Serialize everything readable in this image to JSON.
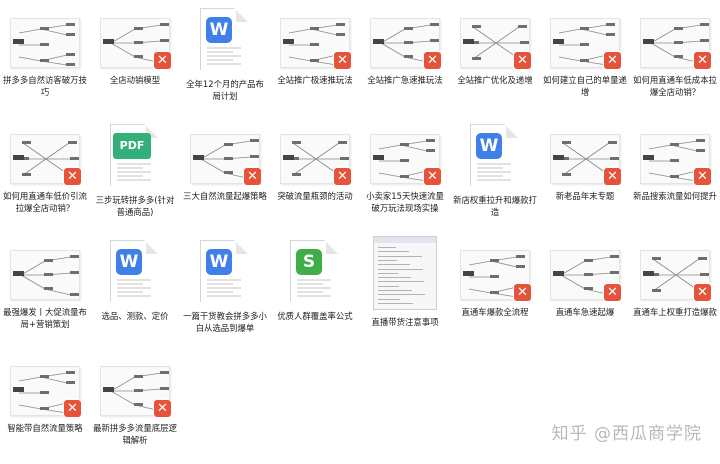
{
  "files": [
    {
      "label": "拼多多自然访客破万技巧",
      "type": "mind",
      "badge": false
    },
    {
      "label": "全店动销模型",
      "type": "mind",
      "badge": true
    },
    {
      "label": "全年12个月的产品布局计划",
      "type": "word",
      "badge": false
    },
    {
      "label": "全站推广极速推玩法",
      "type": "mind",
      "badge": true
    },
    {
      "label": "全站推广急速推玩法",
      "type": "mind",
      "badge": true
    },
    {
      "label": "全站推广优化及递增",
      "type": "mind",
      "badge": true
    },
    {
      "label": "如何建立自己的单量递增",
      "type": "mind",
      "badge": true
    },
    {
      "label": "如何用直通车低成本拉爆全店动销？",
      "type": "mind",
      "badge": true
    },
    {
      "label": "如何用直通车低价引流拉爆全店动销？",
      "type": "mind",
      "badge": true
    },
    {
      "label": "三步玩转拼多多(针对普通商品)",
      "type": "pdf",
      "badge": false
    },
    {
      "label": "三大自然流量起爆策略",
      "type": "mind",
      "badge": true
    },
    {
      "label": "突破流量瓶颈的活动",
      "type": "mind",
      "badge": true
    },
    {
      "label": "小卖家15天快速流量破万玩法现场实操",
      "type": "mind",
      "badge": true
    },
    {
      "label": "新店权重拉升和爆款打造",
      "type": "word",
      "badge": false
    },
    {
      "label": "新老品年末专题",
      "type": "mind",
      "badge": true
    },
    {
      "label": "新品搜索流量如何提升",
      "type": "mind",
      "badge": true
    },
    {
      "label": "最强爆发丨大促流量布局+营销策划",
      "type": "mind",
      "badge": false
    },
    {
      "label": "选品、测款、定价",
      "type": "word",
      "badge": false
    },
    {
      "label": "一篇干货教会拼多多小白从选品到爆单",
      "type": "word",
      "badge": false
    },
    {
      "label": "优质人群覆盖率公式",
      "type": "sheet",
      "badge": false
    },
    {
      "label": "直播带货注意事项",
      "type": "shot",
      "badge": false
    },
    {
      "label": "直通车爆款全流程",
      "type": "mind",
      "badge": true
    },
    {
      "label": "直通车急速起爆",
      "type": "mind",
      "badge": true
    },
    {
      "label": "直通车上权重打造爆款",
      "type": "mind",
      "badge": true
    },
    {
      "label": "智能带自然流量策略",
      "type": "mind",
      "badge": true
    },
    {
      "label": "最新拼多多流量底层逻辑解析",
      "type": "mind",
      "badge": true
    }
  ],
  "icons": {
    "badge": "xmind-badge-icon",
    "word": "W",
    "sheet": "S",
    "pdf": "PDF"
  },
  "watermark": "知乎 @西瓜商学院",
  "colors": {
    "badge": "#e5533a",
    "word": "#3f7fe8",
    "sheet": "#3fae4a",
    "pdf": "#33b079"
  }
}
